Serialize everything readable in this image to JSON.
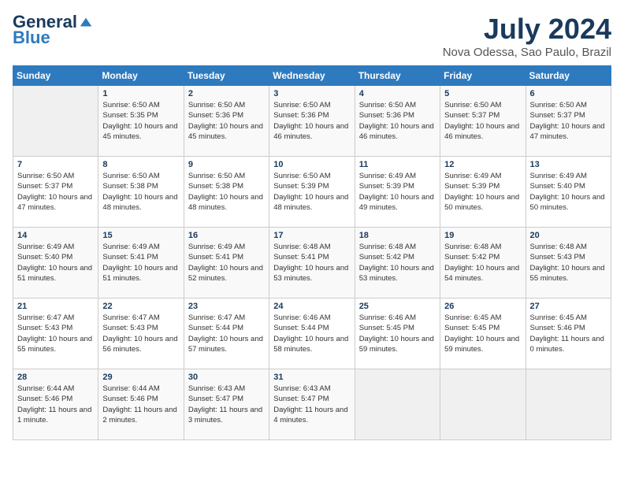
{
  "header": {
    "logo_general": "General",
    "logo_blue": "Blue",
    "month_year": "July 2024",
    "location": "Nova Odessa, Sao Paulo, Brazil"
  },
  "days_of_week": [
    "Sunday",
    "Monday",
    "Tuesday",
    "Wednesday",
    "Thursday",
    "Friday",
    "Saturday"
  ],
  "weeks": [
    [
      {
        "day": "",
        "empty": true
      },
      {
        "day": "1",
        "sunrise": "6:50 AM",
        "sunset": "5:35 PM",
        "daylight": "10 hours and 45 minutes."
      },
      {
        "day": "2",
        "sunrise": "6:50 AM",
        "sunset": "5:36 PM",
        "daylight": "10 hours and 45 minutes."
      },
      {
        "day": "3",
        "sunrise": "6:50 AM",
        "sunset": "5:36 PM",
        "daylight": "10 hours and 46 minutes."
      },
      {
        "day": "4",
        "sunrise": "6:50 AM",
        "sunset": "5:36 PM",
        "daylight": "10 hours and 46 minutes."
      },
      {
        "day": "5",
        "sunrise": "6:50 AM",
        "sunset": "5:37 PM",
        "daylight": "10 hours and 46 minutes."
      },
      {
        "day": "6",
        "sunrise": "6:50 AM",
        "sunset": "5:37 PM",
        "daylight": "10 hours and 47 minutes."
      }
    ],
    [
      {
        "day": "7",
        "sunrise": "6:50 AM",
        "sunset": "5:37 PM",
        "daylight": "10 hours and 47 minutes."
      },
      {
        "day": "8",
        "sunrise": "6:50 AM",
        "sunset": "5:38 PM",
        "daylight": "10 hours and 48 minutes."
      },
      {
        "day": "9",
        "sunrise": "6:50 AM",
        "sunset": "5:38 PM",
        "daylight": "10 hours and 48 minutes."
      },
      {
        "day": "10",
        "sunrise": "6:50 AM",
        "sunset": "5:39 PM",
        "daylight": "10 hours and 48 minutes."
      },
      {
        "day": "11",
        "sunrise": "6:49 AM",
        "sunset": "5:39 PM",
        "daylight": "10 hours and 49 minutes."
      },
      {
        "day": "12",
        "sunrise": "6:49 AM",
        "sunset": "5:39 PM",
        "daylight": "10 hours and 50 minutes."
      },
      {
        "day": "13",
        "sunrise": "6:49 AM",
        "sunset": "5:40 PM",
        "daylight": "10 hours and 50 minutes."
      }
    ],
    [
      {
        "day": "14",
        "sunrise": "6:49 AM",
        "sunset": "5:40 PM",
        "daylight": "10 hours and 51 minutes."
      },
      {
        "day": "15",
        "sunrise": "6:49 AM",
        "sunset": "5:41 PM",
        "daylight": "10 hours and 51 minutes."
      },
      {
        "day": "16",
        "sunrise": "6:49 AM",
        "sunset": "5:41 PM",
        "daylight": "10 hours and 52 minutes."
      },
      {
        "day": "17",
        "sunrise": "6:48 AM",
        "sunset": "5:41 PM",
        "daylight": "10 hours and 53 minutes."
      },
      {
        "day": "18",
        "sunrise": "6:48 AM",
        "sunset": "5:42 PM",
        "daylight": "10 hours and 53 minutes."
      },
      {
        "day": "19",
        "sunrise": "6:48 AM",
        "sunset": "5:42 PM",
        "daylight": "10 hours and 54 minutes."
      },
      {
        "day": "20",
        "sunrise": "6:48 AM",
        "sunset": "5:43 PM",
        "daylight": "10 hours and 55 minutes."
      }
    ],
    [
      {
        "day": "21",
        "sunrise": "6:47 AM",
        "sunset": "5:43 PM",
        "daylight": "10 hours and 55 minutes."
      },
      {
        "day": "22",
        "sunrise": "6:47 AM",
        "sunset": "5:43 PM",
        "daylight": "10 hours and 56 minutes."
      },
      {
        "day": "23",
        "sunrise": "6:47 AM",
        "sunset": "5:44 PM",
        "daylight": "10 hours and 57 minutes."
      },
      {
        "day": "24",
        "sunrise": "6:46 AM",
        "sunset": "5:44 PM",
        "daylight": "10 hours and 58 minutes."
      },
      {
        "day": "25",
        "sunrise": "6:46 AM",
        "sunset": "5:45 PM",
        "daylight": "10 hours and 59 minutes."
      },
      {
        "day": "26",
        "sunrise": "6:45 AM",
        "sunset": "5:45 PM",
        "daylight": "10 hours and 59 minutes."
      },
      {
        "day": "27",
        "sunrise": "6:45 AM",
        "sunset": "5:46 PM",
        "daylight": "11 hours and 0 minutes."
      }
    ],
    [
      {
        "day": "28",
        "sunrise": "6:44 AM",
        "sunset": "5:46 PM",
        "daylight": "11 hours and 1 minute."
      },
      {
        "day": "29",
        "sunrise": "6:44 AM",
        "sunset": "5:46 PM",
        "daylight": "11 hours and 2 minutes."
      },
      {
        "day": "30",
        "sunrise": "6:43 AM",
        "sunset": "5:47 PM",
        "daylight": "11 hours and 3 minutes."
      },
      {
        "day": "31",
        "sunrise": "6:43 AM",
        "sunset": "5:47 PM",
        "daylight": "11 hours and 4 minutes."
      },
      {
        "day": "",
        "empty": true
      },
      {
        "day": "",
        "empty": true
      },
      {
        "day": "",
        "empty": true
      }
    ]
  ]
}
